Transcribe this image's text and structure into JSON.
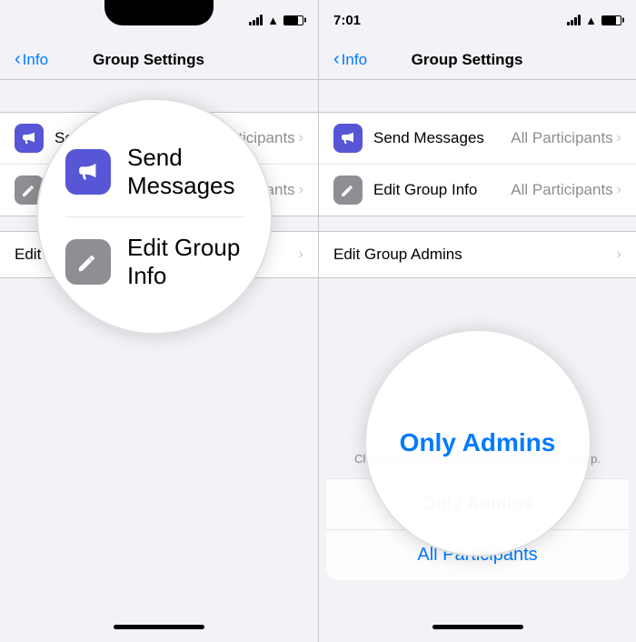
{
  "left_phone": {
    "status": {
      "signal": "signal",
      "wifi": "wifi",
      "battery": "battery"
    },
    "nav": {
      "back_label": "Info",
      "title": "Group Settings"
    },
    "items": [
      {
        "id": "send-messages",
        "icon_type": "purple",
        "icon": "megaphone",
        "label": "Send Messages",
        "value": "All Participants",
        "chevron": "›"
      },
      {
        "id": "edit-group-info",
        "icon_type": "gray",
        "icon": "pencil",
        "label": "Edit Group Info",
        "value": "All Participants",
        "chevron": "›"
      }
    ],
    "section2": {
      "label": "Edit Group Admins",
      "chevron": "›"
    },
    "circle": {
      "item1_label": "Send Messages",
      "item2_label": "Edit Group Info"
    }
  },
  "right_phone": {
    "status": {
      "time": "7:01",
      "signal": "signal",
      "wifi": "wifi",
      "battery": "battery"
    },
    "nav": {
      "back_label": "Info",
      "title": "Group Settings"
    },
    "items": [
      {
        "id": "send-messages",
        "icon_type": "purple",
        "icon": "megaphone",
        "label": "Send Messages",
        "value": "All Participants",
        "chevron": "›"
      },
      {
        "id": "edit-group-info",
        "icon_type": "gray",
        "icon": "pencil",
        "label": "Edit Group Info",
        "value": "All Participants",
        "chevron": "›"
      }
    ],
    "section2": {
      "label": "Edit Group Admins",
      "chevron": "›"
    },
    "action_sheet": {
      "description": "Choose who can add participants to this group.",
      "options": [
        {
          "label": "Only Admins",
          "selected": true
        },
        {
          "label": "All Participants",
          "selected": false
        }
      ]
    },
    "circle_text": "Only Admins"
  }
}
